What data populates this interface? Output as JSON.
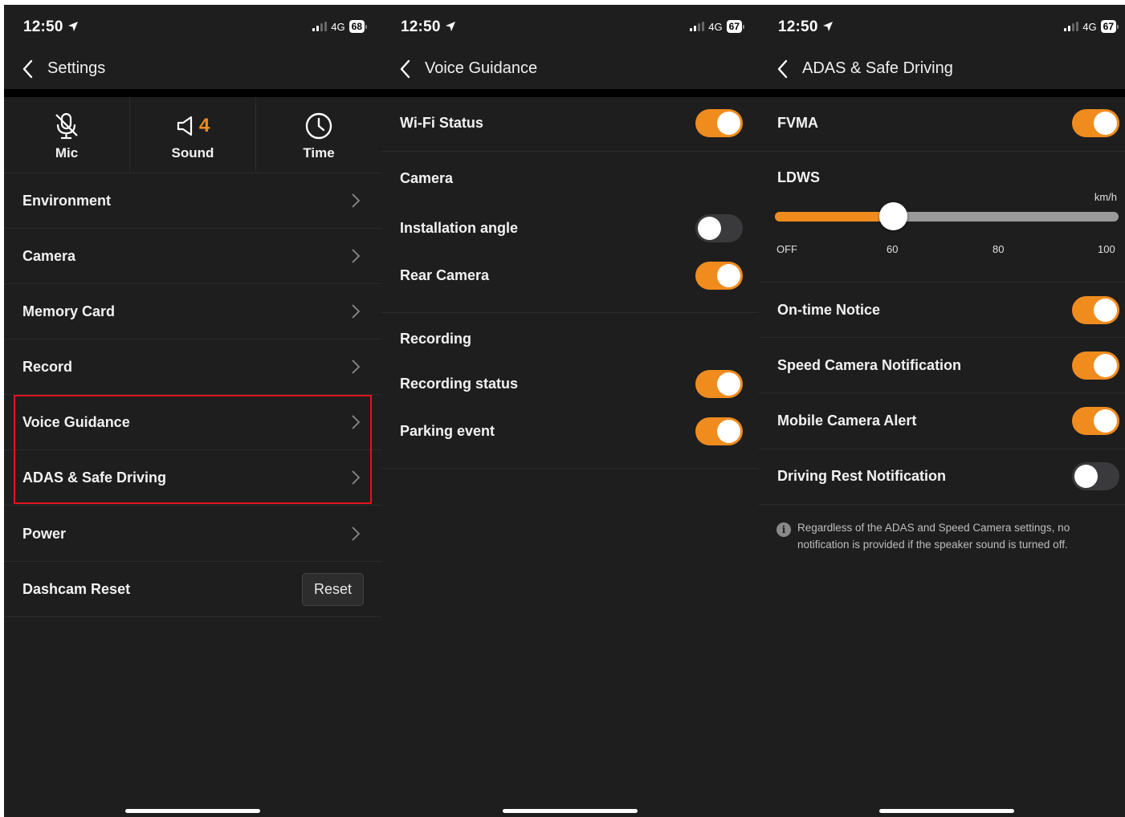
{
  "status": {
    "time": "12:50",
    "network": "4G"
  },
  "screens": [
    {
      "battery": "68",
      "nav_title": "Settings",
      "quick": [
        {
          "label": "Mic",
          "icon": "mic-off-icon"
        },
        {
          "label": "Sound",
          "icon": "speaker-icon",
          "value": "4"
        },
        {
          "label": "Time",
          "icon": "clock-icon"
        }
      ],
      "items": [
        {
          "label": "Environment"
        },
        {
          "label": "Camera"
        },
        {
          "label": "Memory Card"
        },
        {
          "label": "Record"
        },
        {
          "label": "Voice Guidance"
        },
        {
          "label": "ADAS & Safe Driving"
        },
        {
          "label": "Power"
        },
        {
          "label": "Dashcam Reset",
          "button": "Reset"
        }
      ]
    },
    {
      "battery": "67",
      "nav_title": "Voice Guidance",
      "wifi_status": {
        "label": "Wi-Fi Status",
        "on": true
      },
      "camera_section": "Camera",
      "installation_angle": {
        "label": "Installation angle",
        "on": false
      },
      "rear_camera": {
        "label": "Rear Camera",
        "on": true
      },
      "recording_section": "Recording",
      "recording_status": {
        "label": "Recording status",
        "on": true
      },
      "parking_event": {
        "label": "Parking event",
        "on": true
      }
    },
    {
      "battery": "67",
      "nav_title": "ADAS & Safe Driving",
      "fvma": {
        "label": "FVMA",
        "on": true
      },
      "ldws": {
        "label": "LDWS",
        "unit": "km/h",
        "ticks": [
          "OFF",
          "60",
          "80",
          "100"
        ],
        "value": "60"
      },
      "on_time_notice": {
        "label": "On-time Notice",
        "on": true
      },
      "speed_camera": {
        "label": "Speed Camera Notification",
        "on": true
      },
      "mobile_camera": {
        "label": "Mobile Camera Alert",
        "on": true
      },
      "driving_rest": {
        "label": "Driving Rest Notification",
        "on": false
      },
      "note": "Regardless of the ADAS and Speed Camera settings, no notification is provided if the speaker sound is turned off."
    }
  ],
  "colors": {
    "accent": "#f08c1e",
    "background": "#1e1e1e",
    "highlight": "#e0141e"
  }
}
